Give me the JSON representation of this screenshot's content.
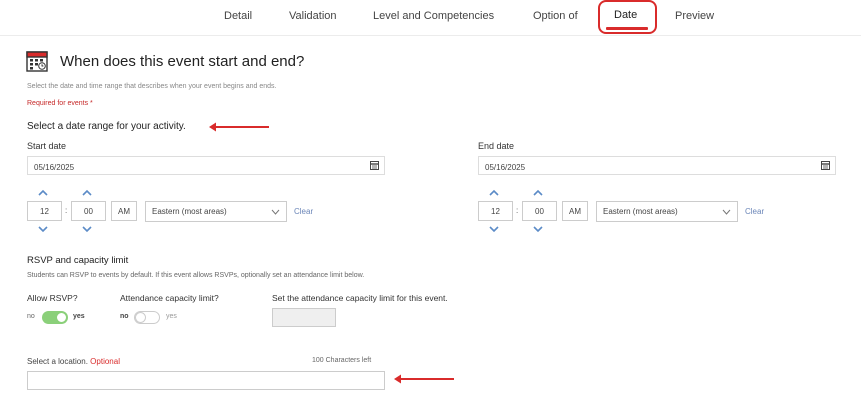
{
  "tabs": [
    {
      "label": "Detail"
    },
    {
      "label": "Validation"
    },
    {
      "label": "Level and Competencies"
    },
    {
      "label": "Option of"
    },
    {
      "label": "Date"
    },
    {
      "label": "Preview"
    }
  ],
  "active_tab": "Date",
  "header": {
    "title": "When does this event start and end?",
    "description": "Select the date and time range that describes when your event begins and ends.",
    "required": "Required for events *"
  },
  "date_range": {
    "heading": "Select a date range for your activity.",
    "start": {
      "label": "Start date",
      "date": "05/16/2025",
      "hour": "12",
      "minute": "00",
      "ampm": "AM",
      "timezone": "Eastern (most areas)",
      "clear": "Clear"
    },
    "end": {
      "label": "End date",
      "date": "05/16/2025",
      "hour": "12",
      "minute": "00",
      "ampm": "AM",
      "timezone": "Eastern (most areas)",
      "clear": "Clear"
    }
  },
  "rsvp": {
    "heading": "RSVP and capacity limit",
    "description": "Students can RSVP to events by default. If this event allows RSVPs, optionally set an attendance limit below.",
    "allow_label": "Allow RSVP?",
    "allow_no": "no",
    "allow_yes": "yes",
    "allow_value": true,
    "capacity_label": "Attendance capacity limit?",
    "capacity_no": "no",
    "capacity_yes": "yes",
    "capacity_value": false,
    "limit_label": "Set the attendance capacity limit for this event.",
    "limit_value": ""
  },
  "location": {
    "label": "Select a location.",
    "optional": "Optional",
    "chars_left": "100 Characters left",
    "value": ""
  },
  "colors": {
    "accent_red": "#d92b2b",
    "toggle_on": "#8bd07a",
    "chevron_blue": "#5b8bc7"
  }
}
